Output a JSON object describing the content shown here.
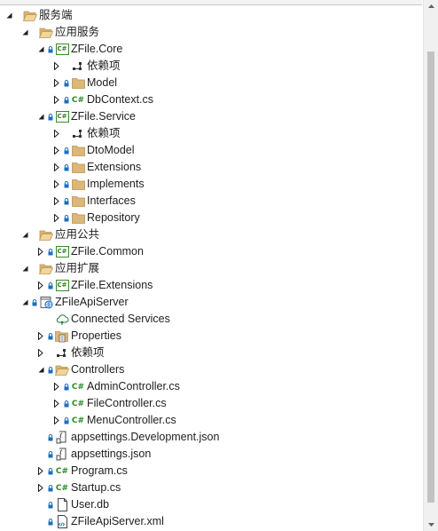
{
  "tree": [
    {
      "label": "服务端",
      "depth": 0,
      "arrow": "expanded",
      "icon": "folder-open",
      "lock": false
    },
    {
      "label": "应用服务",
      "depth": 1,
      "arrow": "expanded",
      "icon": "folder-open",
      "lock": false
    },
    {
      "label": "ZFile.Core",
      "depth": 2,
      "arrow": "expanded",
      "icon": "csproj",
      "lock": true
    },
    {
      "label": "依赖项",
      "depth": 3,
      "arrow": "collapsed",
      "icon": "dependencies",
      "lock": false
    },
    {
      "label": "Model",
      "depth": 3,
      "arrow": "collapsed",
      "icon": "folder",
      "lock": true
    },
    {
      "label": "DbContext.cs",
      "depth": 3,
      "arrow": "collapsed",
      "icon": "csharp",
      "lock": true
    },
    {
      "label": "ZFile.Service",
      "depth": 2,
      "arrow": "expanded",
      "icon": "csproj",
      "lock": true
    },
    {
      "label": "依赖项",
      "depth": 3,
      "arrow": "collapsed",
      "icon": "dependencies",
      "lock": false
    },
    {
      "label": "DtoModel",
      "depth": 3,
      "arrow": "collapsed",
      "icon": "folder",
      "lock": true
    },
    {
      "label": "Extensions",
      "depth": 3,
      "arrow": "collapsed",
      "icon": "folder",
      "lock": true
    },
    {
      "label": "Implements",
      "depth": 3,
      "arrow": "collapsed",
      "icon": "folder",
      "lock": true
    },
    {
      "label": "Interfaces",
      "depth": 3,
      "arrow": "collapsed",
      "icon": "folder",
      "lock": true
    },
    {
      "label": "Repository",
      "depth": 3,
      "arrow": "collapsed",
      "icon": "folder",
      "lock": true
    },
    {
      "label": "应用公共",
      "depth": 1,
      "arrow": "expanded",
      "icon": "folder-open",
      "lock": false
    },
    {
      "label": "ZFile.Common",
      "depth": 2,
      "arrow": "collapsed",
      "icon": "csproj",
      "lock": true
    },
    {
      "label": "应用扩展",
      "depth": 1,
      "arrow": "expanded",
      "icon": "folder-open",
      "lock": false
    },
    {
      "label": "ZFile.Extensions",
      "depth": 2,
      "arrow": "collapsed",
      "icon": "csproj",
      "lock": true
    },
    {
      "label": "ZFileApiServer",
      "depth": 1,
      "arrow": "expanded",
      "icon": "webproj",
      "lock": true
    },
    {
      "label": "Connected Services",
      "depth": 2,
      "arrow": "none",
      "icon": "connected-services",
      "lock": false
    },
    {
      "label": "Properties",
      "depth": 2,
      "arrow": "collapsed",
      "icon": "properties",
      "lock": true
    },
    {
      "label": "依赖项",
      "depth": 2,
      "arrow": "collapsed",
      "icon": "dependencies",
      "lock": false
    },
    {
      "label": "Controllers",
      "depth": 2,
      "arrow": "expanded",
      "icon": "folder-open",
      "lock": true
    },
    {
      "label": "AdminController.cs",
      "depth": 3,
      "arrow": "collapsed",
      "icon": "csharp",
      "lock": true
    },
    {
      "label": "FileController.cs",
      "depth": 3,
      "arrow": "collapsed",
      "icon": "csharp",
      "lock": true
    },
    {
      "label": "MenuController.cs",
      "depth": 3,
      "arrow": "collapsed",
      "icon": "csharp",
      "lock": true
    },
    {
      "label": "appsettings.Development.json",
      "depth": 2,
      "arrow": "none",
      "icon": "json",
      "lock": true
    },
    {
      "label": "appsettings.json",
      "depth": 2,
      "arrow": "none",
      "icon": "json",
      "lock": true
    },
    {
      "label": "Program.cs",
      "depth": 2,
      "arrow": "collapsed",
      "icon": "csharp",
      "lock": true
    },
    {
      "label": "Startup.cs",
      "depth": 2,
      "arrow": "collapsed",
      "icon": "csharp",
      "lock": true
    },
    {
      "label": "User.db",
      "depth": 2,
      "arrow": "none",
      "icon": "file",
      "lock": true
    },
    {
      "label": "ZFileApiServer.xml",
      "depth": 2,
      "arrow": "none",
      "icon": "xml",
      "lock": true
    }
  ],
  "colors": {
    "folder": "#dcb67a",
    "lock": "#1b6ec2",
    "csharp": "#2b8a2b",
    "arrow": "#1e1e1e",
    "text": "#1e1e1e"
  }
}
